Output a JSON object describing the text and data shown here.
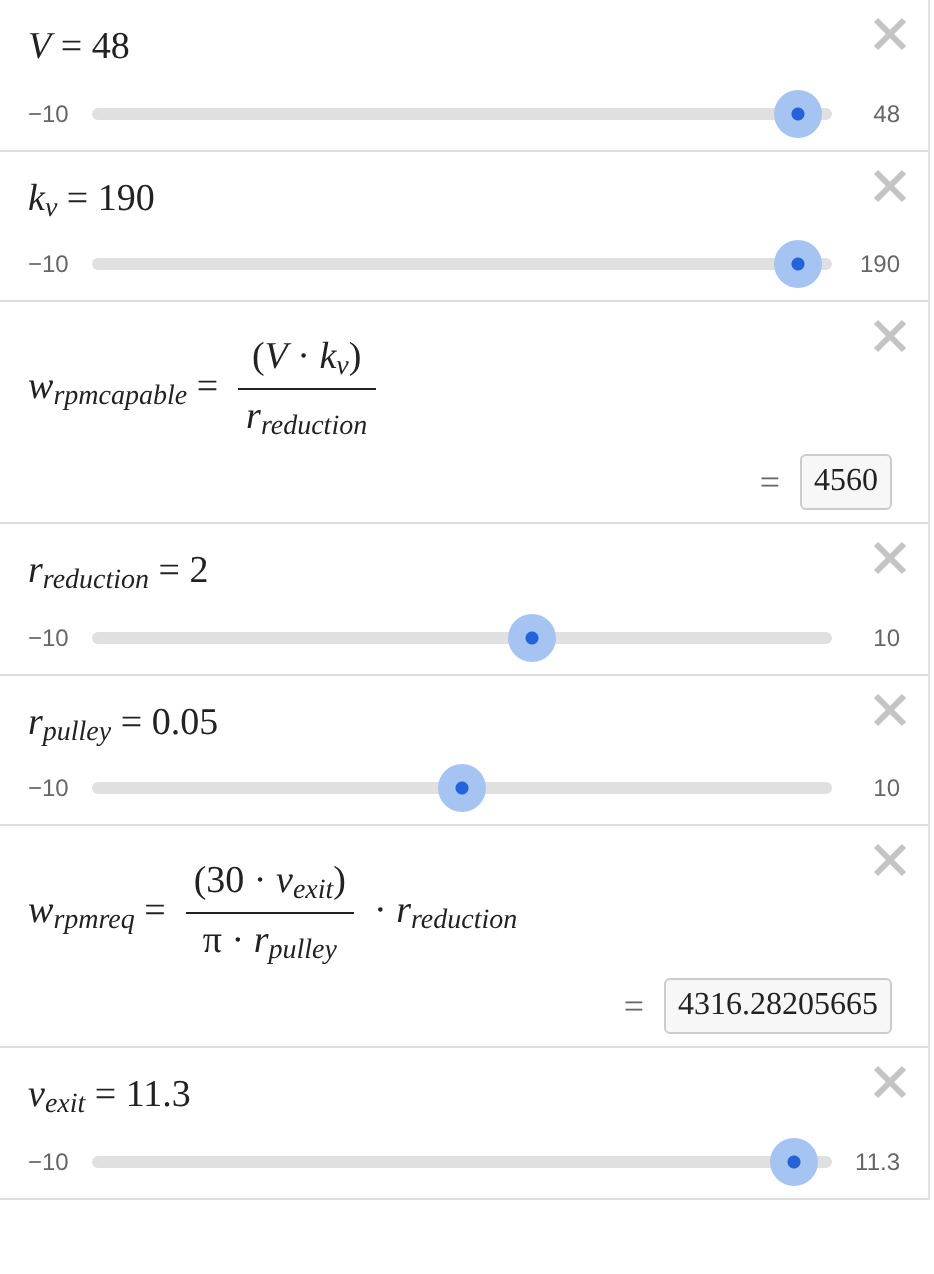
{
  "expressions": [
    {
      "kind": "slider",
      "math": "*V* = 48",
      "min": "−10",
      "max": "48",
      "level": 0.985
    },
    {
      "kind": "slider",
      "math": "*k*$_{v}$ = 190",
      "min": "−10",
      "max": "190",
      "level": 0.985
    },
    {
      "kind": "formula",
      "lhs": "*w*$_{rpmcapable}$ =",
      "numerator": "(*V* · *k*$_{v}$)",
      "denominator": "*r*$_{reduction}$",
      "result_prefix": "=",
      "result": "4560"
    },
    {
      "kind": "slider",
      "math": "*r*$_{reduction}$ = 2",
      "min": "−10",
      "max": "10",
      "level": 0.6
    },
    {
      "kind": "slider",
      "math": "*r*$_{pulley}$ = 0.05",
      "min": "−10",
      "max": "10",
      "level": 0.5
    },
    {
      "kind": "formula",
      "lhs": "*w*$_{rpmreq}$ =",
      "numerator": "(30 · *v*$_{exit}$)",
      "denominator": "π · *r*$_{pulley}$",
      "tail": "· *r*$_{reduction}$",
      "result_prefix": "=",
      "result": "4316.28205665"
    },
    {
      "kind": "slider",
      "math": "*v*$_{exit}$ = 11.3",
      "min": "−10",
      "max": "11.3",
      "level": 0.98
    }
  ]
}
